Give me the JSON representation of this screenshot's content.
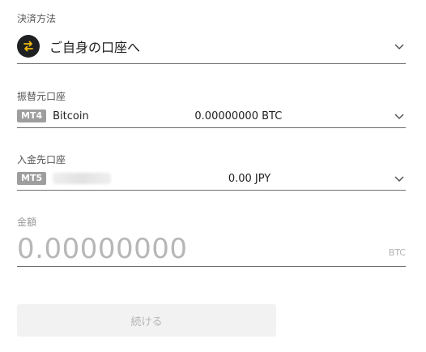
{
  "payment_method": {
    "label": "決済方法",
    "value": "ご自身の口座へ"
  },
  "from_account": {
    "label": "振替元口座",
    "badge": "MT4",
    "name": "Bitcoin",
    "balance": "0.00000000 BTC"
  },
  "to_account": {
    "label": "入金先口座",
    "badge": "MT5",
    "balance": "0.00 JPY"
  },
  "amount": {
    "label": "金額",
    "value": "0.00000000",
    "unit": "BTC"
  },
  "continue_button": {
    "label": "続ける"
  },
  "colors": {
    "accent_icon": "#f0b90b",
    "icon_bg": "#1e2022"
  }
}
